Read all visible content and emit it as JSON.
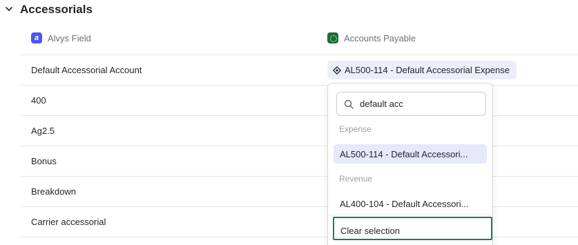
{
  "section": {
    "title": "Accessorials",
    "expanded": true
  },
  "columns": {
    "left": {
      "label": "Alvys Field",
      "logo_letter": "a",
      "icon": "alvys-logo-icon"
    },
    "right": {
      "label": "Accounts Payable",
      "icon": "quickbooks-logo-icon"
    }
  },
  "rows": [
    {
      "label": "Default Accessorial Account"
    },
    {
      "label": "400"
    },
    {
      "label": "Ag2.5"
    },
    {
      "label": "Bonus"
    },
    {
      "label": "Breakdown"
    },
    {
      "label": "Carrier accessorial"
    }
  ],
  "mapping": {
    "selected_value": "AL500-114 - Default Accessorial Expense",
    "icon": "target-icon"
  },
  "dropdown": {
    "search_value": "default acc",
    "groups": [
      {
        "label": "Expense",
        "options": [
          {
            "label": "AL500-114 - Default Accessori...",
            "selected": true
          }
        ]
      },
      {
        "label": "Revenue",
        "options": [
          {
            "label": "AL400-104 - Default Accessori...",
            "selected": false
          }
        ]
      }
    ],
    "clear_label": "Clear selection"
  },
  "colors": {
    "accent_selected": "#e5e9fb",
    "focus_outline": "#1a7f4e",
    "alvys_brand": "#4f55e8",
    "qb_brand": "#1c6b3a"
  }
}
